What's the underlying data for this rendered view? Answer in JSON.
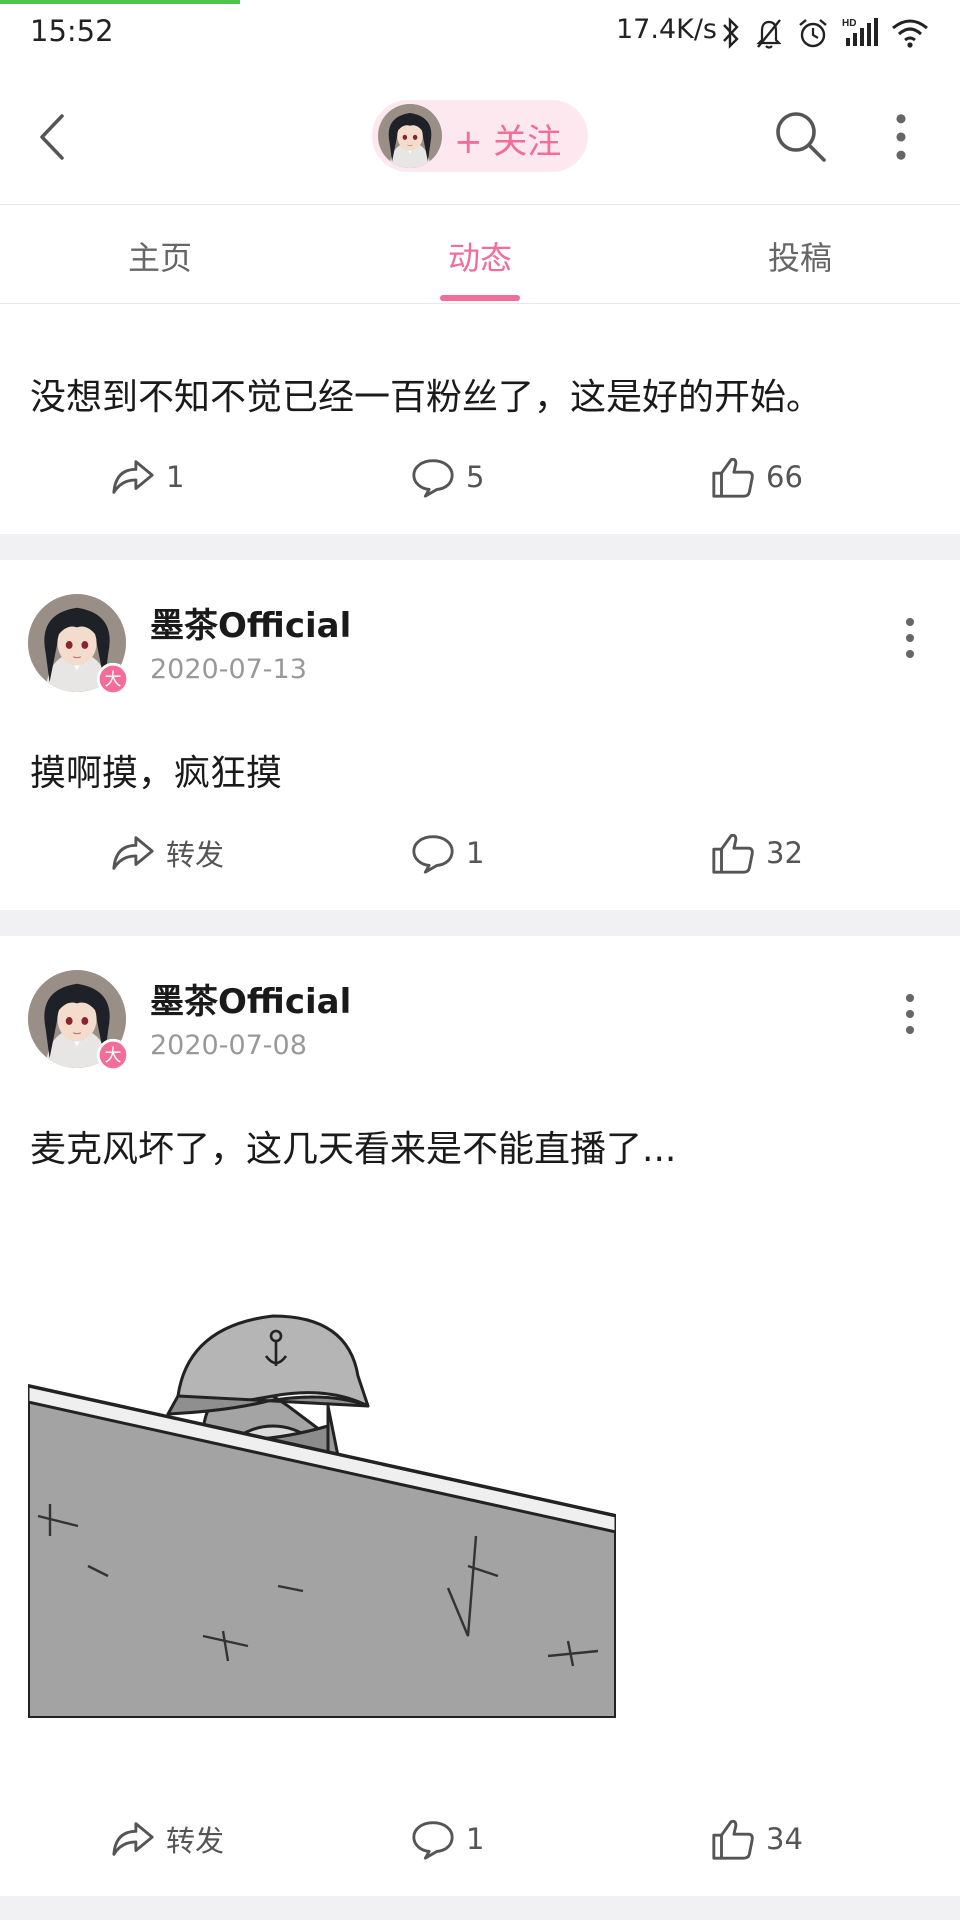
{
  "status_bar": {
    "time": "15:52",
    "network_speed": "17.4K/s",
    "page_load_progress": 0.25,
    "icons": [
      "bluetooth-icon",
      "mute-bell-icon",
      "alarm-icon",
      "hd-signal-icon",
      "wifi-icon"
    ]
  },
  "header": {
    "follow_label": "+ 关注",
    "icons": [
      "back-arrow-icon",
      "search-icon",
      "more-vertical-icon"
    ]
  },
  "tabs": {
    "items": [
      {
        "label": "主页",
        "active": false
      },
      {
        "label": "动态",
        "active": true
      },
      {
        "label": "投稿",
        "active": false
      }
    ]
  },
  "colors": {
    "accent": "#f26d97",
    "follow_bg": "#fde8ef",
    "badge": "#f26d97",
    "divider": "#f1f1f3",
    "progress": "#4cc64a"
  },
  "posts": [
    {
      "author": "",
      "date": "",
      "text": "没想到不知不觉已经一百粉丝了，这是好的开始。",
      "repost_label": "1",
      "comment_label": "5",
      "like_label": "66",
      "truncated_top": true
    },
    {
      "author": "墨茶Official",
      "date": "2020-07-13",
      "text": "摸啊摸，疯狂摸",
      "repost_label": "转发",
      "comment_label": "1",
      "like_label": "32"
    },
    {
      "author": "墨茶Official",
      "date": "2020-07-08",
      "text": "麦克风坏了，这几天看来是不能直播了...",
      "image": "cartoon-girl-helmet-behind-wall",
      "repost_label": "转发",
      "comment_label": "1",
      "like_label": "34"
    }
  ]
}
